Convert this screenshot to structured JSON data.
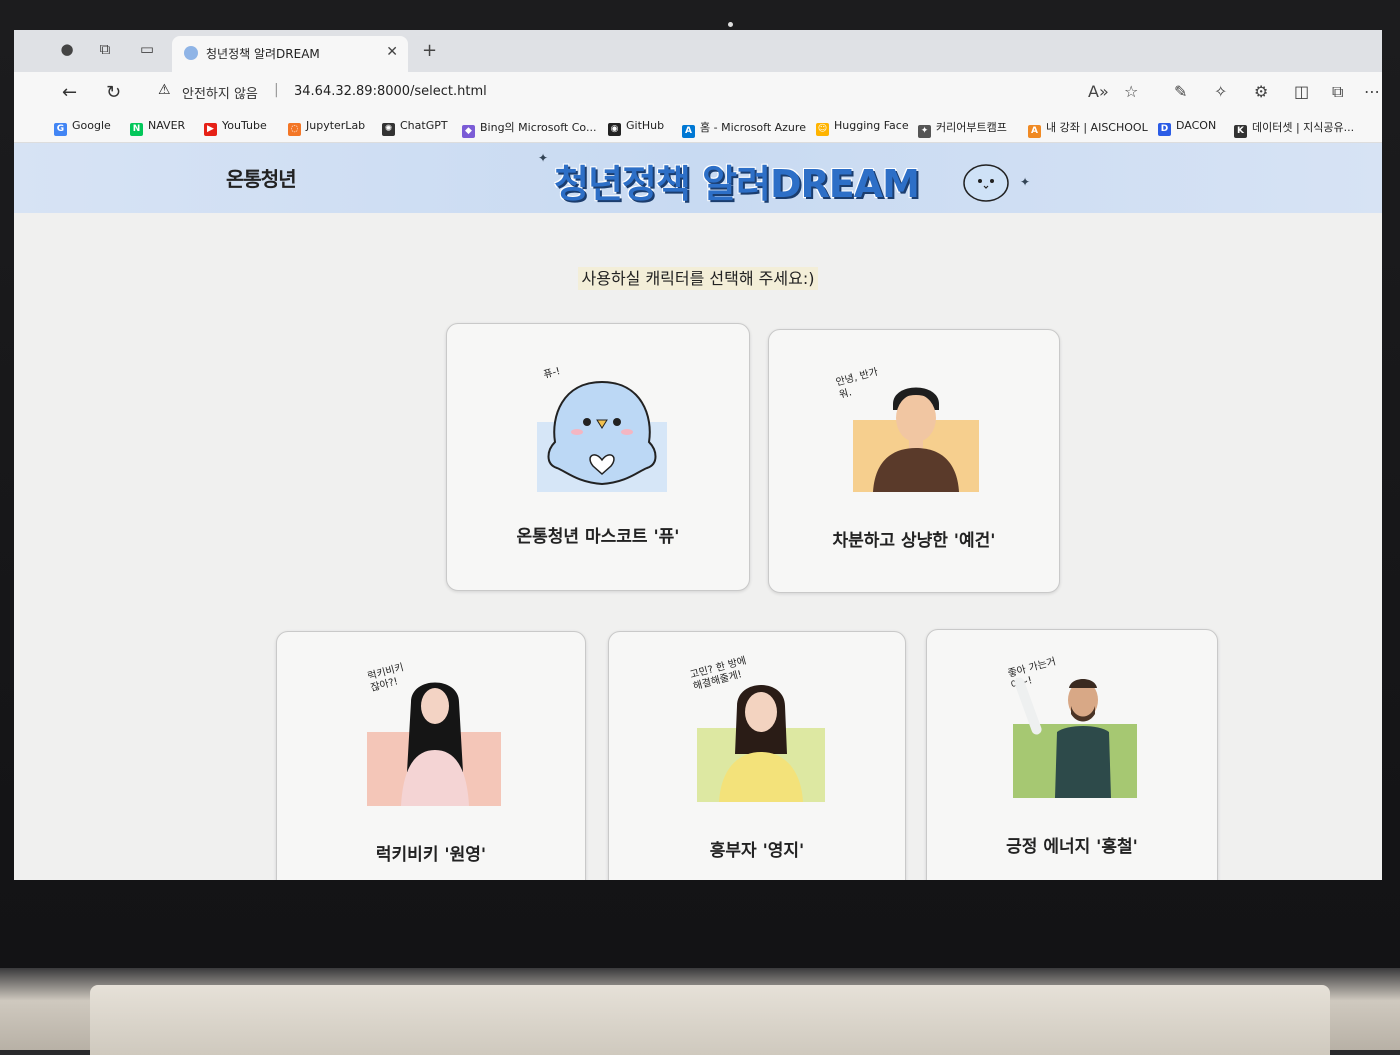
{
  "browser": {
    "tab_title": "청년정책 알려DREAM",
    "security_warning": "안전하지 않음",
    "url": "34.64.32.89:8000/select.html",
    "bookmarks": [
      {
        "label": "Google",
        "icon": "google-icon",
        "color": "#4285f4"
      },
      {
        "label": "NAVER",
        "icon": "naver-icon",
        "color": "#03c75a"
      },
      {
        "label": "YouTube",
        "icon": "youtube-icon",
        "color": "#e62117"
      },
      {
        "label": "JupyterLab",
        "icon": "jupyter-icon",
        "color": "#f37626"
      },
      {
        "label": "ChatGPT",
        "icon": "chatgpt-icon",
        "color": "#333333"
      },
      {
        "label": "Bing의 Microsoft Co...",
        "icon": "copilot-icon",
        "color": "#7b5cd6"
      },
      {
        "label": "GitHub",
        "icon": "github-icon",
        "color": "#222222"
      },
      {
        "label": "홈 - Microsoft Azure",
        "icon": "azure-icon",
        "color": "#0078d4"
      },
      {
        "label": "Hugging Face",
        "icon": "huggingface-icon",
        "color": "#ffb400"
      },
      {
        "label": "커리어부트캠프",
        "icon": "bootcamp-icon",
        "color": "#555555"
      },
      {
        "label": "내 강좌 | AISCHOOL",
        "icon": "aischool-icon",
        "color": "#f08a24"
      },
      {
        "label": "DACON",
        "icon": "dacon-icon",
        "color": "#2b5ce6"
      },
      {
        "label": "데이터셋 | 지식공유...",
        "icon": "kaggle-k-icon",
        "color": "#333333"
      }
    ]
  },
  "header": {
    "logo_text": "온통청년",
    "title": "청년정책 알려DREAM"
  },
  "main": {
    "prompt": "사용하실 캐릭터를 선택해 주세요:)",
    "characters": [
      {
        "label": "온통청년 마스코트 '퓨'",
        "speech": "퓨-!",
        "bg": "#d6e6f7"
      },
      {
        "label": "차분하고 상냥한 '예건'",
        "speech": "안녕, 반가워.",
        "bg": "#f6cf8e"
      },
      {
        "label": "럭키비키 '원영'",
        "speech": "럭키비키 잖아?!",
        "bg": "#f4c6b8"
      },
      {
        "label": "흥부자 '영지'",
        "speech": "고민? 한 방에 해결해줄게!",
        "bg": "#dde8a2"
      },
      {
        "label": "긍정 에너지 '홍철'",
        "speech": "좋아 가는거야~!",
        "bg": "#a6c872"
      }
    ]
  }
}
